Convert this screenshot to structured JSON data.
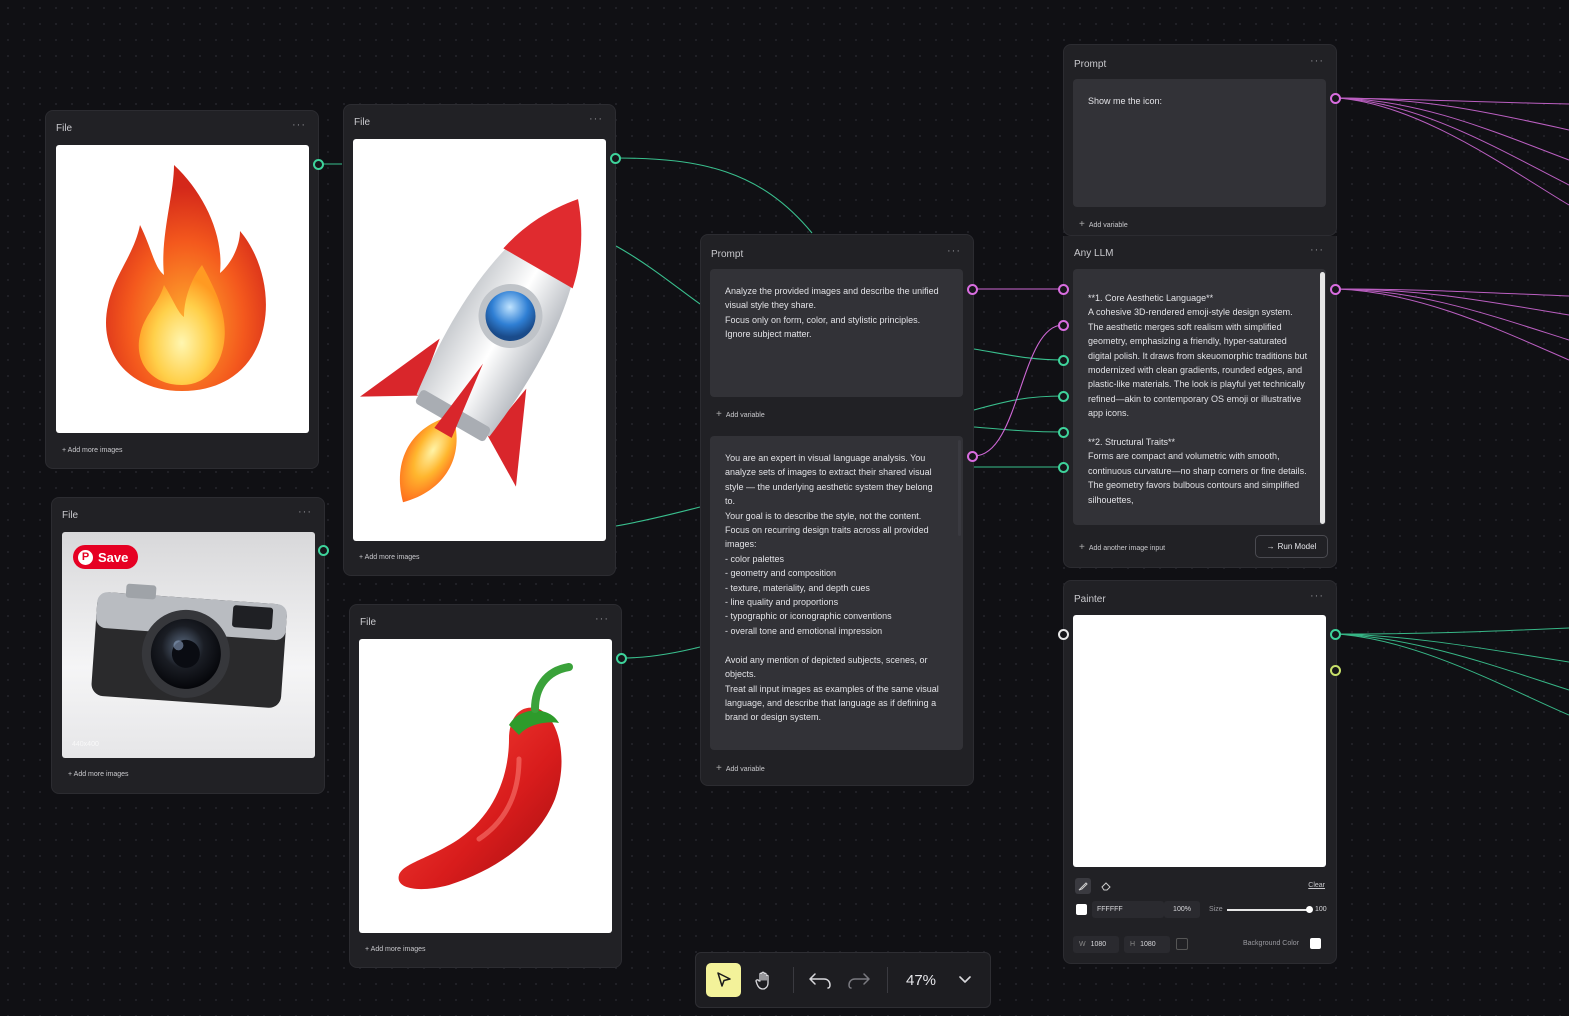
{
  "nodes": {
    "file1": {
      "title": "File",
      "menu": "···",
      "add_more": "+ Add more images"
    },
    "file2": {
      "title": "File",
      "menu": "···",
      "add_more": "+ Add more images"
    },
    "file3": {
      "title": "File",
      "menu": "···",
      "add_more": "+ Add more images",
      "save_label": "Save",
      "image_size": "440x400"
    },
    "file4": {
      "title": "File",
      "menu": "···",
      "add_more": "+ Add more images"
    },
    "prompt_main": {
      "title": "Prompt",
      "menu": "···",
      "text": "Analyze the provided images and describe the unified visual style they share.\nFocus only on form, color, and stylistic principles. Ignore subject matter.",
      "add_variable_1": "Add variable",
      "system_text": "You are an expert in visual language analysis. You analyze sets of images to extract their shared visual style — the underlying aesthetic system they belong to.\nYour goal is to describe the style, not the content.\nFocus on recurring design traits across all provided images:\n- color palettes\n- geometry and composition\n- texture, materiality, and depth cues\n- line quality and proportions\n- typographic or iconographic conventions\n- overall tone and emotional impression\n\nAvoid any mention of depicted subjects, scenes, or objects.\nTreat all input images as examples of the same visual language, and describe that language as if defining a brand or design system.",
      "add_variable_2": "Add variable"
    },
    "prompt_top": {
      "title": "Prompt",
      "menu": "···",
      "text": "Show me the icon:",
      "add_variable": "Add variable"
    },
    "any_llm": {
      "title": "Any LLM",
      "menu": "···",
      "output": "**1. Core Aesthetic Language**\nA cohesive 3D-rendered emoji-style design system. The aesthetic merges soft realism with simplified geometry, emphasizing a friendly, hyper-saturated digital polish. It draws from skeuomorphic traditions but modernized with clean gradients, rounded edges, and plastic-like materials. The look is playful yet technically refined—akin to contemporary OS emoji or illustrative app icons.\n\n**2. Structural Traits**\nForms are compact and volumetric with smooth, continuous curvature—no sharp corners or fine details. The geometry favors bulbous contours and simplified silhouettes,",
      "add_image_input": "Add another image input",
      "run_button": "Run Model",
      "run_arrow": "→"
    },
    "painter": {
      "title": "Painter",
      "menu": "···",
      "clear": "Clear",
      "color_hex": "FFFFFF",
      "opacity": "100%",
      "size_label": "Size",
      "size_value": "100",
      "size_fraction": 1.0,
      "w_label": "W",
      "w_value": "1080",
      "h_label": "H",
      "h_value": "1080",
      "bg_label": "Background Color"
    }
  },
  "toolbar": {
    "zoom": "47%"
  },
  "colors": {
    "teal": "#3ed39b",
    "pink": "#d96de0",
    "accent": "#f3f29a"
  }
}
